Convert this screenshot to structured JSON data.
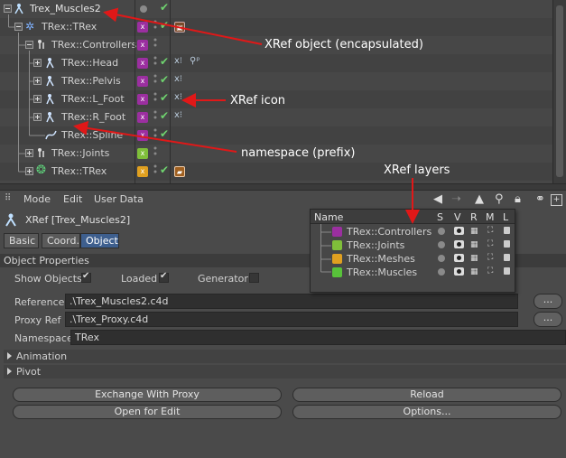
{
  "object_manager": {
    "rows": [
      {
        "name": "Trex_Muscles2"
      },
      {
        "name": "TRex::TRex"
      },
      {
        "name": "TRex::Controllers"
      },
      {
        "name": "TRex::Head"
      },
      {
        "name": "TRex::Pelvis"
      },
      {
        "name": "TRex::L_Foot"
      },
      {
        "name": "TRex::R_Foot"
      },
      {
        "name": "TRex::Spline"
      },
      {
        "name": "TRex::Joints"
      },
      {
        "name": "TRex::TRex"
      }
    ]
  },
  "annotations": {
    "xref_object": "XRef object (encapsulated)",
    "xref_icon": "XRef icon",
    "namespace": "namespace (prefix)",
    "xref_layers": "XRef layers"
  },
  "attribute_manager": {
    "menu": [
      "Mode",
      "Edit",
      "User Data"
    ],
    "title": "XRef [Trex_Muscles2]",
    "tabs": [
      "Basic",
      "Coord.",
      "Object"
    ],
    "section_title": "Object Properties",
    "show_objects_label": "Show Objects",
    "loaded_label": "Loaded",
    "generator_label": "Generator",
    "reference_label": "Reference",
    "reference_value": ".\\Trex_Muscles2.c4d",
    "proxy_ref_label": "Proxy Ref",
    "proxy_ref_value": ".\\Trex_Proxy.c4d",
    "namespace_label": "Namespace",
    "namespace_value": "TRex",
    "browse_label": "...",
    "groups": [
      "Animation",
      "Pivot"
    ],
    "buttons": {
      "exchange": "Exchange With Proxy",
      "reload": "Reload",
      "open_edit": "Open for Edit",
      "options": "Options..."
    }
  },
  "layers": {
    "columns": [
      "Name",
      "S",
      "V",
      "R",
      "M",
      "L"
    ],
    "items": [
      {
        "name": "TRex::Controllers",
        "color": "#9b2fa0"
      },
      {
        "name": "TRex::Joints",
        "color": "#7fbf3a"
      },
      {
        "name": "TRex::Meshes",
        "color": "#e0a020"
      },
      {
        "name": "TRex::Muscles",
        "color": "#58c23a"
      }
    ]
  },
  "colors": {
    "accent_tab": "#3e5f8e",
    "annotation_arrow": "#e01818",
    "check": "#6fd36f"
  }
}
